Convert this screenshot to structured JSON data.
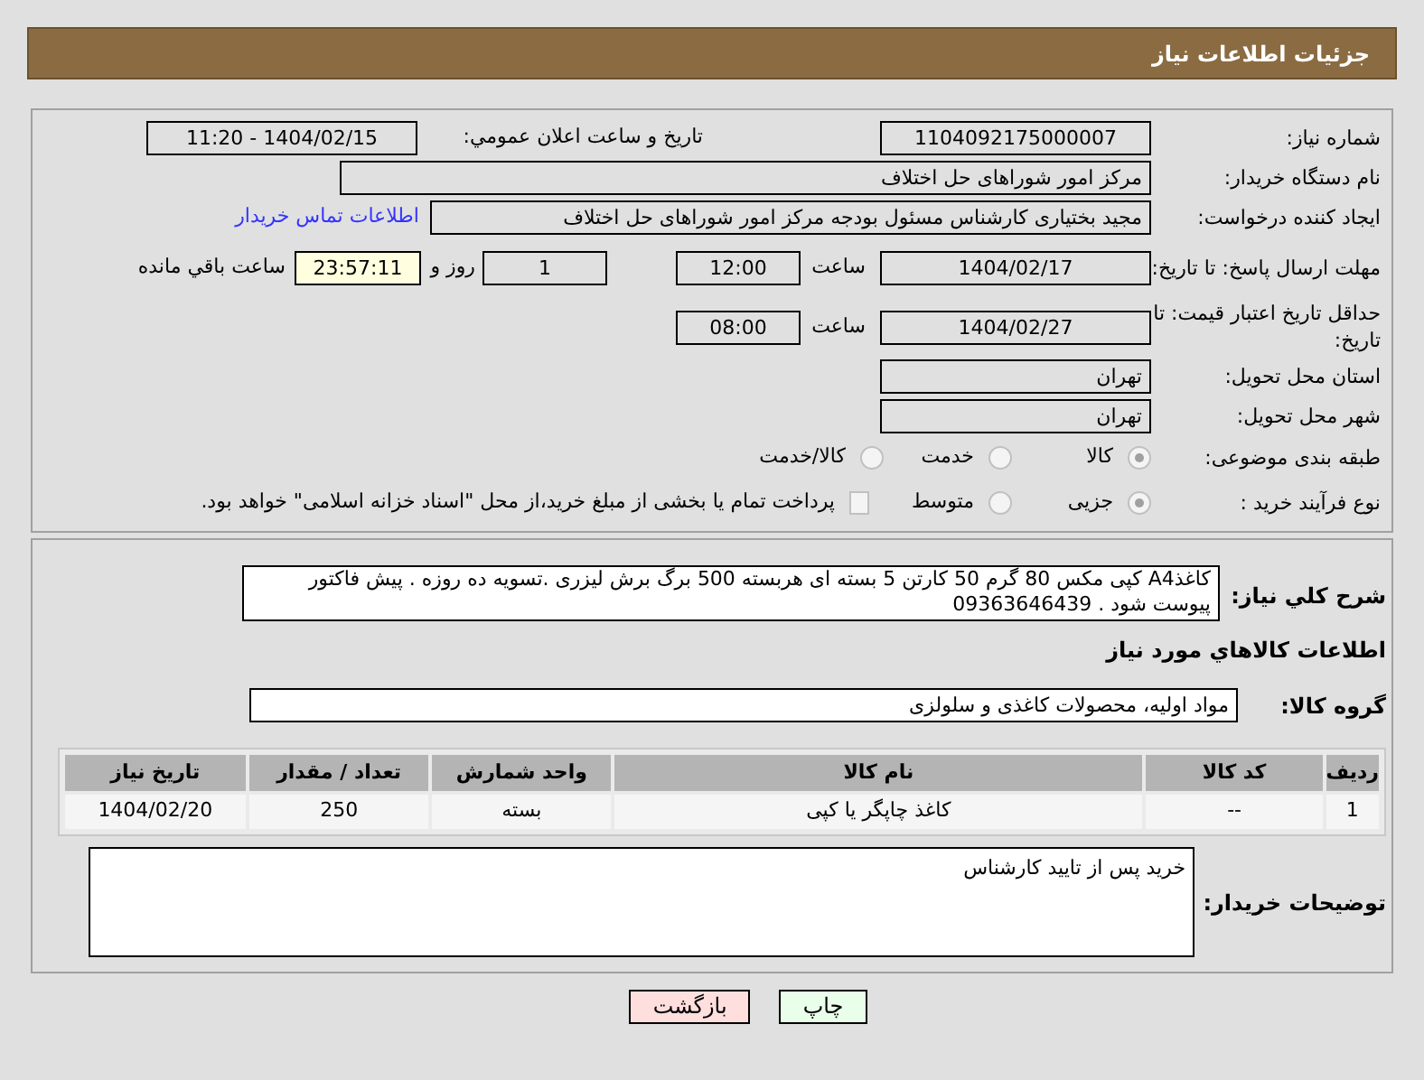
{
  "header": {
    "title": "جزئیات اطلاعات نیاز"
  },
  "form": {
    "need_number": {
      "label": "شماره نیاز:",
      "value": "1104092175000007"
    },
    "announce": {
      "label": "تاریخ و ساعت اعلان عمومي:",
      "value": "1404/02/15 - 11:20"
    },
    "buyer_org": {
      "label": "نام دستگاه خریدار:",
      "value": "مرکز امور شوراهای حل اختلاف"
    },
    "requester": {
      "label": "ایجاد کننده درخواست:",
      "value": "مجید بختیاری کارشناس مسئول بودجه مرکز امور شوراهای حل اختلاف",
      "link": "اطلاعات تماس خریدار"
    },
    "reply_deadline": {
      "label": "مهلت ارسال پاسخ: تا تاریخ:",
      "date": "1404/02/17",
      "time_label": "ساعت",
      "time": "12:00",
      "days": "1",
      "days_label": "روز و",
      "remaining": "23:57:11",
      "remaining_label": "ساعت باقي مانده"
    },
    "price_validity": {
      "label": "حداقل تاریخ اعتبار قیمت: تا تاریخ:",
      "date": "1404/02/27",
      "time_label": "ساعت",
      "time": "08:00"
    },
    "province": {
      "label": "استان محل تحویل:",
      "value": "تهران"
    },
    "city": {
      "label": "شهر محل تحویل:",
      "value": "تهران"
    },
    "category": {
      "label": "طبقه بندی موضوعی:",
      "options": [
        {
          "label": "کالا",
          "selected": true
        },
        {
          "label": "خدمت",
          "selected": false
        },
        {
          "label": "کالا/خدمت",
          "selected": false
        }
      ]
    },
    "purchase_type": {
      "label": "نوع فرآیند خرید :",
      "options": [
        {
          "label": "جزیی",
          "selected": true
        },
        {
          "label": "متوسط",
          "selected": false
        }
      ],
      "treasury": {
        "checked": false,
        "text": "پرداخت تمام یا بخشی از مبلغ خرید،از محل \"اسناد خزانه اسلامی\" خواهد بود."
      }
    }
  },
  "details": {
    "description": {
      "label": "شرح کلي نياز:",
      "value": "کاغذA4 کپی مکس  80 گرم 50 کارتن 5 بسته ای هربسته 500 برگ برش لیزری .تسویه ده روزه . پیش فاکتور پیوست شود . 09363646439"
    },
    "goods_heading": "اطلاعات کالاهاي مورد نياز",
    "goods_group": {
      "label": "گروه کالا:",
      "value": "مواد اولیه، محصولات کاغذی و سلولزی"
    },
    "table": {
      "columns": [
        "ردیف",
        "کد کالا",
        "نام کالا",
        "واحد شمارش",
        "تعداد / مقدار",
        "تاریخ نیاز"
      ],
      "rows": [
        [
          "1",
          "--",
          "کاغذ چاپگر یا کپی",
          "بسته",
          "250",
          "1404/02/20"
        ]
      ]
    },
    "buyer_notes": {
      "label": "توضیحات خریدار:",
      "value": "خرید پس از تایید کارشناس"
    }
  },
  "buttons": [
    {
      "label": "چاپ",
      "kind": "print"
    },
    {
      "label": "بازگشت",
      "kind": "back"
    }
  ]
}
